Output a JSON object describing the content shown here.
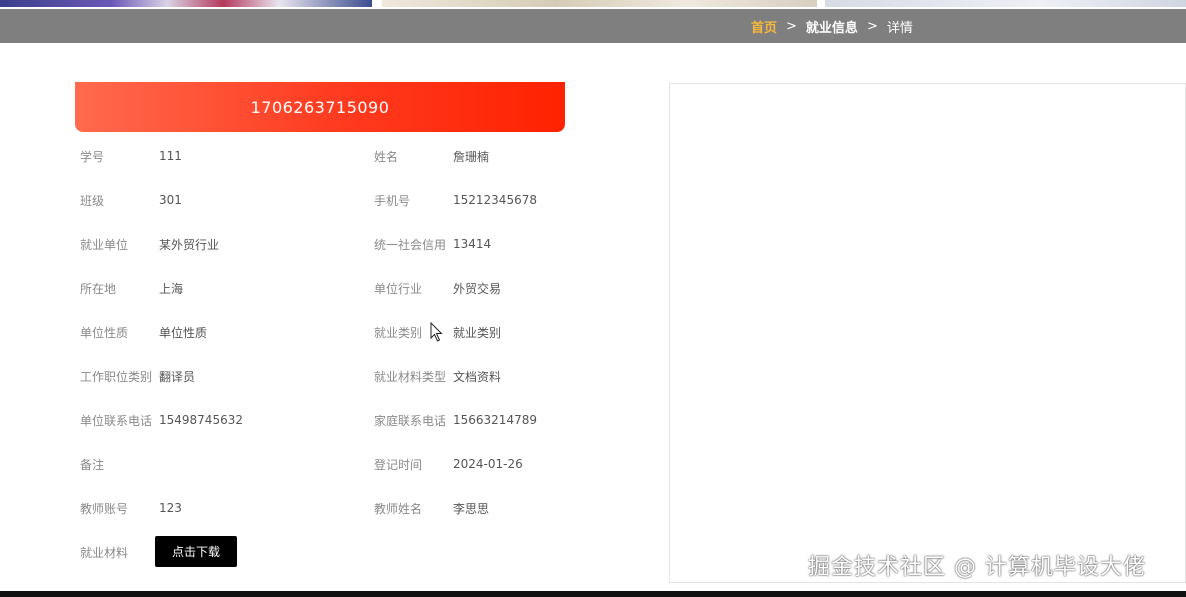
{
  "breadcrumb": {
    "home": "首页",
    "section": "就业信息",
    "current": "详情",
    "sep": ">"
  },
  "detail": {
    "title": "1706263715090",
    "left_fields": [
      {
        "label": "学号",
        "value": "111"
      },
      {
        "label": "班级",
        "value": "301"
      },
      {
        "label": "就业单位",
        "value": "某外贸行业"
      },
      {
        "label": "所在地",
        "value": "上海"
      },
      {
        "label": "单位性质",
        "value": "单位性质"
      },
      {
        "label": "工作职位类别",
        "value": "翻译员"
      },
      {
        "label": "单位联系电话",
        "value": "15498745632"
      },
      {
        "label": "备注",
        "value": ""
      },
      {
        "label": "教师账号",
        "value": "123"
      },
      {
        "label": "就业材料",
        "value": ""
      }
    ],
    "right_fields": [
      {
        "label": "姓名",
        "value": "詹珊楠"
      },
      {
        "label": "手机号",
        "value": "15212345678"
      },
      {
        "label": "统一社会信用",
        "value": "13414"
      },
      {
        "label": "单位行业",
        "value": "外贸交易"
      },
      {
        "label": "就业类别",
        "value": "就业类别"
      },
      {
        "label": "就业材料类型",
        "value": "文档资料"
      },
      {
        "label": "家庭联系电话",
        "value": "15663214789"
      },
      {
        "label": "登记时间",
        "value": "2024-01-26"
      },
      {
        "label": "教师姓名",
        "value": "李思思"
      }
    ],
    "download_label": "点击下载"
  },
  "watermark": "掘金技术社区 @ 计算机毕设大佬",
  "colors": {
    "header_start": "#ff6a4d",
    "header_end": "#ff2200",
    "breadcrumb_bg": "#7f7f7f",
    "home_link": "#f6b73c"
  }
}
